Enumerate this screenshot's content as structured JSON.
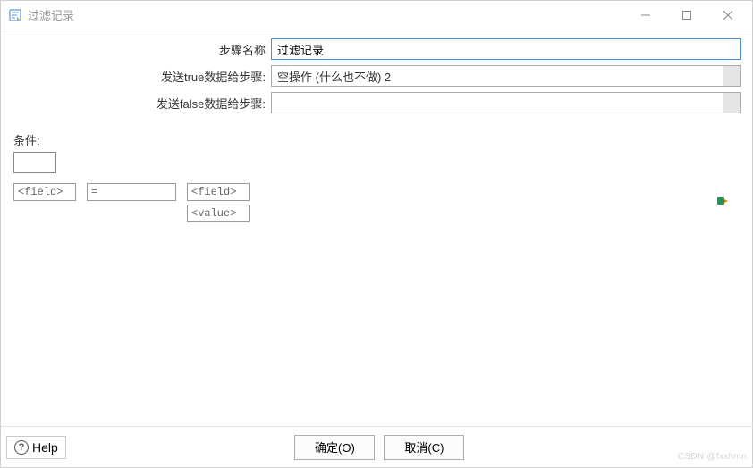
{
  "window": {
    "title": "过滤记录"
  },
  "form": {
    "step_name_label": "步骤名称",
    "step_name_value": "过滤记录",
    "send_true_label": "发送true数据给步骤:",
    "send_true_value": "空操作 (什么也不做) 2",
    "send_false_label": "发送false数据给步骤:",
    "send_false_value": ""
  },
  "condition": {
    "label": "条件:",
    "field1_placeholder": "<field>",
    "operator_placeholder": "=",
    "field2_placeholder": "<field>",
    "value_placeholder": "<value>"
  },
  "footer": {
    "help": "Help",
    "ok": "确定(O)",
    "cancel": "取消(C)"
  },
  "watermark": "CSDN @fxxhmn"
}
